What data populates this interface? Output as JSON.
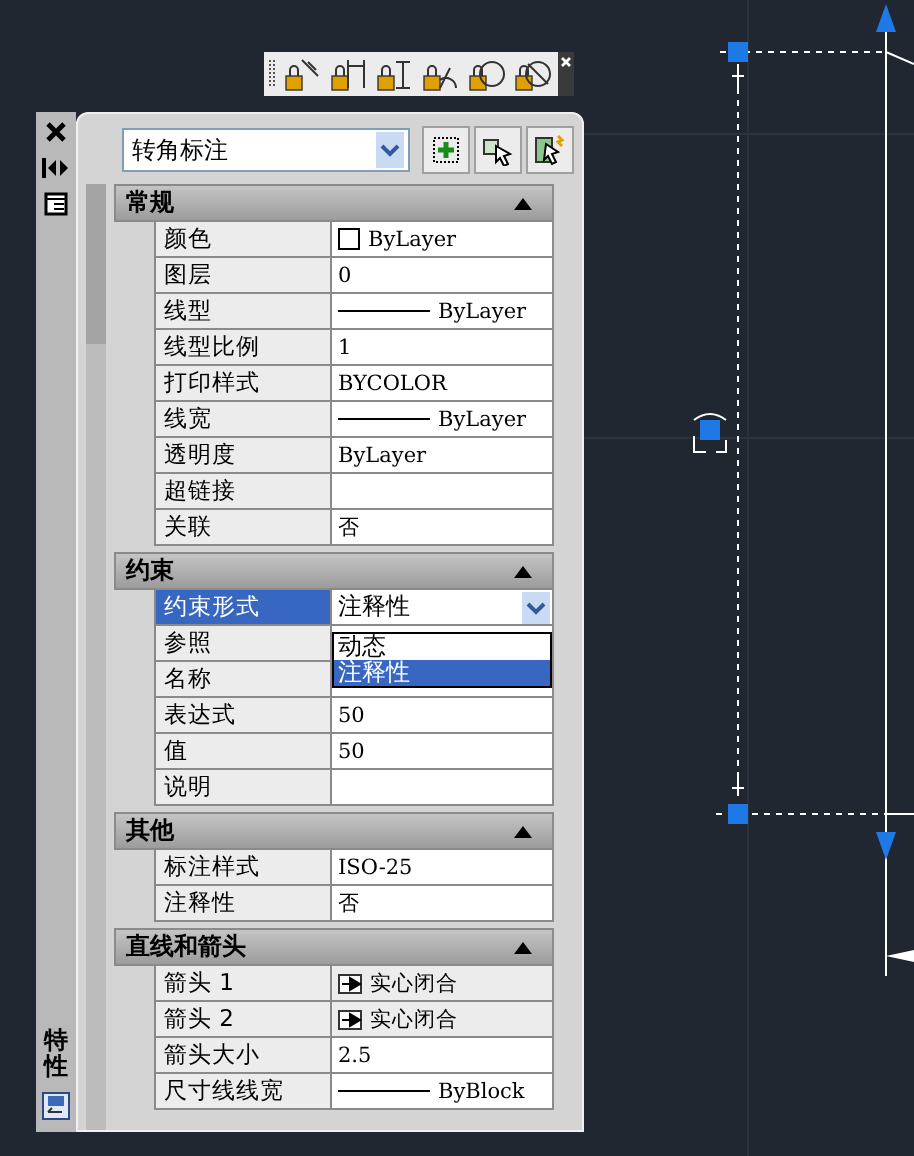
{
  "palette": {
    "side_title": "特性",
    "object_type": "转角标注",
    "sections": [
      {
        "title": "常规",
        "expanded": true,
        "rows": [
          {
            "label": "颜色",
            "value": "ByLayer",
            "kind": "color",
            "selected": false
          },
          {
            "label": "图层",
            "value": "0",
            "kind": "text",
            "selected": false
          },
          {
            "label": "线型",
            "value": "ByLayer",
            "kind": "linetype",
            "selected": false
          },
          {
            "label": "线型比例",
            "value": "1",
            "kind": "text",
            "selected": false
          },
          {
            "label": "打印样式",
            "value": "BYCOLOR",
            "kind": "text",
            "selected": false
          },
          {
            "label": "线宽",
            "value": "ByLayer",
            "kind": "linetype",
            "selected": false
          },
          {
            "label": "透明度",
            "value": "ByLayer",
            "kind": "text",
            "selected": false
          },
          {
            "label": "超链接",
            "selected": false
          },
          {
            "label": "关联",
            "value": "否",
            "kind": "text",
            "selected": false
          }
        ]
      },
      {
        "title": "约束",
        "expanded": true,
        "rows": [
          {
            "label": "约束形式",
            "value": "注释性",
            "kind": "combo",
            "selected": true,
            "options": [
              {
                "label": "动态",
                "selected": false
              },
              {
                "label": "注释性",
                "selected": true
              }
            ]
          },
          {
            "label": "参照",
            "selected": false
          },
          {
            "label": "名称",
            "selected": false
          },
          {
            "label": "表达式",
            "value": "50",
            "kind": "text",
            "selected": false
          },
          {
            "label": "值",
            "value": "50",
            "kind": "text",
            "selected": false
          },
          {
            "label": "说明",
            "selected": false
          }
        ]
      },
      {
        "title": "其他",
        "expanded": true,
        "rows": [
          {
            "label": "标注样式",
            "value": "ISO-25",
            "kind": "text",
            "selected": false
          },
          {
            "label": "注释性",
            "value": "否",
            "kind": "text",
            "selected": false
          }
        ]
      },
      {
        "title": "直线和箭头",
        "expanded": true,
        "rows": [
          {
            "label": "箭头 1",
            "value": "实心闭合",
            "kind": "arrow",
            "selected": false
          },
          {
            "label": "箭头 2",
            "value": "实心闭合",
            "kind": "arrow",
            "selected": false
          },
          {
            "label": "箭头大小",
            "value": "2.5",
            "kind": "text",
            "selected": false
          },
          {
            "label": "尺寸线线宽",
            "value": "ByBlock",
            "kind": "linetype",
            "selected": false
          }
        ]
      }
    ]
  }
}
